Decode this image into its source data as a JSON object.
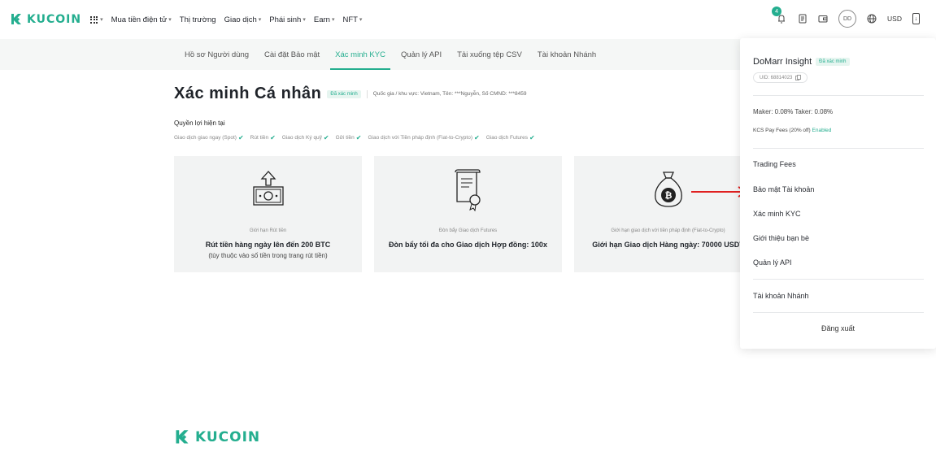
{
  "brand": {
    "name": "KUCOIN",
    "color": "#24ae8f"
  },
  "nav": {
    "items": [
      {
        "label": "Mua tiền điện tử",
        "dropdown": true
      },
      {
        "label": "Thị trường",
        "dropdown": false
      },
      {
        "label": "Giao dịch",
        "dropdown": true
      },
      {
        "label": "Phái sinh",
        "dropdown": true
      },
      {
        "label": "Earn",
        "dropdown": true
      },
      {
        "label": "NFT",
        "dropdown": true
      }
    ],
    "notification_count": "4",
    "avatar_initials": "DD",
    "currency": "USD",
    "icons": [
      "apps-grid-icon",
      "bell-icon",
      "orders-icon",
      "wallet-icon",
      "globe-icon",
      "download-icon"
    ]
  },
  "subnav": {
    "tabs": [
      {
        "label": "Hồ sơ Người dùng",
        "active": false
      },
      {
        "label": "Cài đặt Bảo mật",
        "active": false
      },
      {
        "label": "Xác minh KYC",
        "active": true
      },
      {
        "label": "Quản lý API",
        "active": false
      },
      {
        "label": "Tải xuống tệp CSV",
        "active": false
      },
      {
        "label": "Tài khoản Nhánh",
        "active": false
      }
    ]
  },
  "kyc": {
    "title": "Xác minh Cá nhân",
    "status": "Đã xác minh",
    "info": "Quốc gia / khu vực:  Vietnam,  Tên:  ***Nguyễn,  Số CMND:  ***8459",
    "benefits_heading": "Quyền lợi hiện tại",
    "benefits": [
      "Giao dịch giao ngay (Spot)",
      "Rút tiền",
      "Giao dịch Ký quỹ",
      "Gửi tiền",
      "Giao dịch với Tiền pháp định (Fiat-to-Crypto)",
      "Giao dịch Futures"
    ],
    "cards": [
      {
        "icon": "withdraw-cash-icon",
        "title": "Giới hạn Rút tiền",
        "value": "Rút tiền hàng ngày lên đến 200 BTC",
        "sub": "(tùy thuộc vào số tiền trong trang rút tiền)"
      },
      {
        "icon": "certificate-icon",
        "title": "Đòn bẩy Giao dịch Futures",
        "value": "Đòn bẩy tối đa cho Giao dịch Hợp đồng: 100x",
        "sub": ""
      },
      {
        "icon": "bitcoin-bag-icon",
        "title": "Giới hạn giao dịch với tiền pháp định (Fiat-to-Crypto)",
        "value": "Giới hạn Giao dịch Hàng ngày: 70000 USDT",
        "sub": ""
      }
    ]
  },
  "account_menu": {
    "name": "DoMarr Insight",
    "verified": "Đã xác minh",
    "uid": "UID: 68814023",
    "fees": "Maker: 0.08%   Taker: 0.08%",
    "kcs_label": "KCS Pay Fees (20% off)",
    "kcs_status": "Enabled",
    "items": [
      {
        "label": "Trading Fees"
      },
      {
        "label": "Bảo mật Tài khoản"
      },
      {
        "label": "Xác minh KYC"
      },
      {
        "label": "Giới thiệu bạn bè"
      },
      {
        "label": "Quản lý API"
      },
      {
        "label": "Tài khoản Nhánh"
      }
    ],
    "logout": "Đăng xuất"
  },
  "annotation": {
    "arrow_color": "#e02020"
  }
}
